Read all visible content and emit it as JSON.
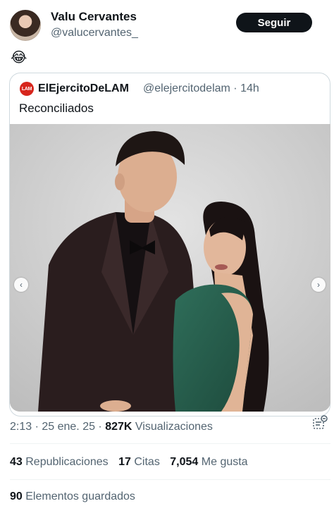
{
  "post": {
    "author_name": "Valu Cervantes",
    "author_handle": "@valucervantes_",
    "follow_label": "Seguir",
    "text": "😂"
  },
  "quote": {
    "logo_text": "LAM",
    "author_name": "ElEjercitoDeLAM",
    "author_handle": "@elejercitodelam · 14h",
    "text": "Reconciliados"
  },
  "meta": {
    "time_date": "2:13 · 25 ene. 25 · ",
    "views_count": "827K",
    "views_label": " Visualizaciones"
  },
  "stats": {
    "reposts_count": "43",
    "reposts_label": "Republicaciones",
    "quotes_count": "17",
    "quotes_label": "Citas",
    "likes_count": "7,054",
    "likes_label": "Me gusta",
    "bookmarks_count": "90",
    "bookmarks_label": "Elementos guardados"
  },
  "colors": {
    "text_primary": "#0f1419",
    "text_secondary": "#536471",
    "border": "#cfd9de",
    "lam_red": "#d7261d"
  },
  "icons": {
    "prev": "‹",
    "next": "›"
  }
}
